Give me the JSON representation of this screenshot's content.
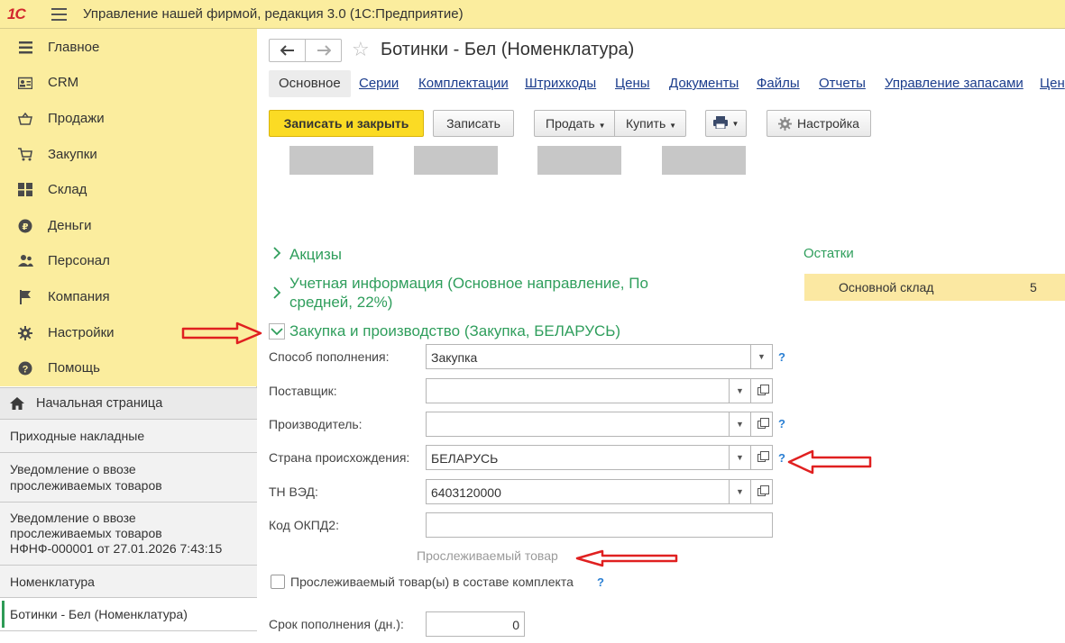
{
  "app": {
    "logo": "1С",
    "title": "Управление нашей фирмой, редакция 3.0  (1С:Предприятие)"
  },
  "sidebar": {
    "nav": [
      {
        "label": "Главное",
        "icon": "menu-icon"
      },
      {
        "label": "CRM",
        "icon": "contact-card-icon"
      },
      {
        "label": "Продажи",
        "icon": "basket-icon"
      },
      {
        "label": "Закупки",
        "icon": "cart-icon"
      },
      {
        "label": "Склад",
        "icon": "warehouse-icon"
      },
      {
        "label": "Деньги",
        "icon": "coin-icon"
      },
      {
        "label": "Персонал",
        "icon": "people-icon"
      },
      {
        "label": "Компания",
        "icon": "flag-icon"
      },
      {
        "label": "Настройки",
        "icon": "gear-icon"
      },
      {
        "label": "Помощь",
        "icon": "help-icon"
      }
    ],
    "history": [
      {
        "label": "Начальная страница"
      },
      {
        "label": "Приходные накладные"
      },
      {
        "line1": "Уведомление о ввозе",
        "line2": "прослеживаемых товаров"
      },
      {
        "line1": "Уведомление о ввозе",
        "line2": "прослеживаемых товаров",
        "line3": "НФНФ-000001 от 27.01.2026 7:43:15"
      },
      {
        "label": "Номенклатура"
      },
      {
        "label": "Ботинки - Бел (Номенклатура)"
      }
    ]
  },
  "form": {
    "title": "Ботинки - Бел (Номенклатура)",
    "tabs": [
      "Основное",
      "Серии",
      "Комплектации",
      "Штрихкоды",
      "Цены",
      "Документы",
      "Файлы",
      "Отчеты",
      "Управление запасами",
      "Цен"
    ],
    "toolbar": {
      "save_close": "Записать и закрыть",
      "save": "Записать",
      "sell": "Продать",
      "buy": "Купить",
      "settings": "Настройка"
    },
    "groups": {
      "excise": "Акцизы",
      "accounting_l1": "Учетная информация (Основное направление, По",
      "accounting_l2": "средней, 22%)",
      "purchase": "Закупка и производство (Закупка, БЕЛАРУСЬ)"
    },
    "fields": {
      "replenishment": {
        "label": "Способ пополнения:",
        "value": "Закупка"
      },
      "supplier": {
        "label": "Поставщик:",
        "value": ""
      },
      "manufacturer": {
        "label": "Производитель:",
        "value": ""
      },
      "country": {
        "label": "Страна происхождения:",
        "value": "БЕЛАРУСЬ"
      },
      "tnved": {
        "label": "ТН ВЭД:",
        "value": "6403120000"
      },
      "okpd2": {
        "label": "Код ОКПД2:",
        "value": ""
      },
      "lead_time": {
        "label": "Срок пополнения (дн.):",
        "value": "0"
      }
    },
    "traceable_label": "Прослеживаемый товар",
    "kit_checkbox": {
      "label": "Прослеживаемый товар(ы) в составе комплекта",
      "checked": false
    },
    "help_mark": "?"
  },
  "stock": {
    "title": "Остатки",
    "rows": [
      {
        "warehouse": "Основной склад",
        "qty": "5"
      }
    ]
  },
  "colors": {
    "accent_yellow": "#fbed9e",
    "green": "#2f9e5c",
    "annotation_red": "#e02020"
  }
}
